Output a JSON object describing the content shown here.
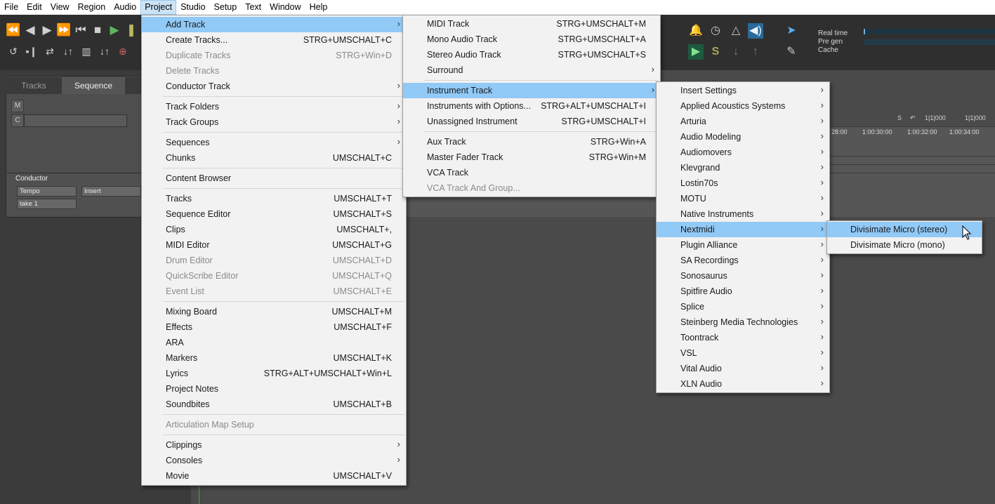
{
  "menubar": [
    "File",
    "Edit",
    "View",
    "Region",
    "Audio",
    "Project",
    "Studio",
    "Setup",
    "Text",
    "Window",
    "Help"
  ],
  "menubar_active": "Project",
  "status": {
    "real_time": "Real time",
    "pre_gen": "Pre gen",
    "cache": "Cache"
  },
  "left_panel": {
    "tabs": [
      "Tracks",
      "Sequence"
    ],
    "m_btn": "M",
    "c_btn": "C",
    "conductor": "Conductor",
    "tempo": "Tempo",
    "insert": "Insert",
    "take": "take 1"
  },
  "timeline": {
    "s_btn": "S",
    "pos1": "1|1|000",
    "pos2": "1|1|000",
    "times": [
      "28:00",
      "1:00:30:00",
      "1:00:32:00",
      "1:00:34:00"
    ]
  },
  "project_menu": [
    {
      "label": "Add Track",
      "shortcut": "",
      "arrow": true,
      "highlight": true
    },
    {
      "label": "Create Tracks...",
      "shortcut": "STRG+UMSCHALT+C"
    },
    {
      "label": "Duplicate Tracks",
      "shortcut": "STRG+Win+D",
      "disabled": true
    },
    {
      "label": "Delete Tracks",
      "shortcut": "",
      "disabled": true
    },
    {
      "label": "Conductor Track",
      "shortcut": "",
      "arrow": true
    },
    {
      "sep": true
    },
    {
      "label": "Track Folders",
      "shortcut": "",
      "arrow": true
    },
    {
      "label": "Track Groups",
      "shortcut": "",
      "arrow": true
    },
    {
      "sep": true
    },
    {
      "label": "Sequences",
      "shortcut": "",
      "arrow": true
    },
    {
      "label": "Chunks",
      "shortcut": "UMSCHALT+C"
    },
    {
      "sep": true
    },
    {
      "label": "Content Browser",
      "shortcut": ""
    },
    {
      "sep": true
    },
    {
      "label": "Tracks",
      "shortcut": "UMSCHALT+T"
    },
    {
      "label": "Sequence Editor",
      "shortcut": "UMSCHALT+S"
    },
    {
      "label": "Clips",
      "shortcut": "UMSCHALT+,"
    },
    {
      "label": "MIDI Editor",
      "shortcut": "UMSCHALT+G"
    },
    {
      "label": "Drum Editor",
      "shortcut": "UMSCHALT+D",
      "disabled": true
    },
    {
      "label": "QuickScribe Editor",
      "shortcut": "UMSCHALT+Q",
      "disabled": true
    },
    {
      "label": "Event List",
      "shortcut": "UMSCHALT+E",
      "disabled": true
    },
    {
      "sep": true
    },
    {
      "label": "Mixing Board",
      "shortcut": "UMSCHALT+M"
    },
    {
      "label": "Effects",
      "shortcut": "UMSCHALT+F"
    },
    {
      "label": "ARA",
      "shortcut": ""
    },
    {
      "label": "Markers",
      "shortcut": "UMSCHALT+K"
    },
    {
      "label": "Lyrics",
      "shortcut": "STRG+ALT+UMSCHALT+Win+L"
    },
    {
      "label": "Project Notes",
      "shortcut": ""
    },
    {
      "label": "Soundbites",
      "shortcut": "UMSCHALT+B"
    },
    {
      "sep": true
    },
    {
      "label": "Articulation Map Setup",
      "shortcut": "",
      "disabled": true
    },
    {
      "sep": true
    },
    {
      "label": "Clippings",
      "shortcut": "",
      "arrow": true
    },
    {
      "label": "Consoles",
      "shortcut": "",
      "arrow": true
    },
    {
      "label": "Movie",
      "shortcut": "UMSCHALT+V"
    }
  ],
  "add_track_menu": [
    {
      "label": "MIDI Track",
      "shortcut": "STRG+UMSCHALT+M"
    },
    {
      "label": "Mono Audio Track",
      "shortcut": "STRG+UMSCHALT+A"
    },
    {
      "label": "Stereo Audio Track",
      "shortcut": "STRG+UMSCHALT+S"
    },
    {
      "label": "Surround",
      "shortcut": "",
      "arrow": true
    },
    {
      "sep": true
    },
    {
      "label": "Instrument Track",
      "shortcut": "",
      "arrow": true,
      "highlight": true
    },
    {
      "label": "Instruments with Options...",
      "shortcut": "STRG+ALT+UMSCHALT+I"
    },
    {
      "label": "Unassigned Instrument",
      "shortcut": "STRG+UMSCHALT+I"
    },
    {
      "sep": true
    },
    {
      "label": "Aux Track",
      "shortcut": "STRG+Win+A"
    },
    {
      "label": "Master Fader Track",
      "shortcut": "STRG+Win+M"
    },
    {
      "label": "VCA Track",
      "shortcut": ""
    },
    {
      "label": "VCA Track And Group...",
      "shortcut": "",
      "disabled": true
    }
  ],
  "instrument_menu": [
    {
      "label": "Insert Settings",
      "arrow": true
    },
    {
      "label": "Applied Acoustics Systems",
      "arrow": true
    },
    {
      "label": "Arturia",
      "arrow": true
    },
    {
      "label": "Audio Modeling",
      "arrow": true
    },
    {
      "label": "Audiomovers",
      "arrow": true
    },
    {
      "label": "Klevgrand",
      "arrow": true
    },
    {
      "label": "Lostin70s",
      "arrow": true
    },
    {
      "label": "MOTU",
      "arrow": true
    },
    {
      "label": "Native Instruments",
      "arrow": true
    },
    {
      "label": "Nextmidi",
      "arrow": true,
      "highlight": true
    },
    {
      "label": "Plugin Alliance",
      "arrow": true
    },
    {
      "label": "SA Recordings",
      "arrow": true
    },
    {
      "label": "Sonosaurus",
      "arrow": true
    },
    {
      "label": "Spitfire Audio",
      "arrow": true
    },
    {
      "label": "Splice",
      "arrow": true
    },
    {
      "label": "Steinberg Media Technologies",
      "arrow": true
    },
    {
      "label": "Toontrack",
      "arrow": true
    },
    {
      "label": "VSL",
      "arrow": true
    },
    {
      "label": "Vital Audio",
      "arrow": true
    },
    {
      "label": "XLN Audio",
      "arrow": true
    }
  ],
  "nextmidi_menu": [
    {
      "label": "Divisimate Micro (stereo)",
      "highlight": true
    },
    {
      "label": "Divisimate Micro (mono)"
    }
  ],
  "colors": {
    "highlight": "#91c9f7",
    "menu_bg": "#f2f2f2",
    "disabled": "#8a8a8a",
    "app_bg": "#4a4a4a"
  }
}
